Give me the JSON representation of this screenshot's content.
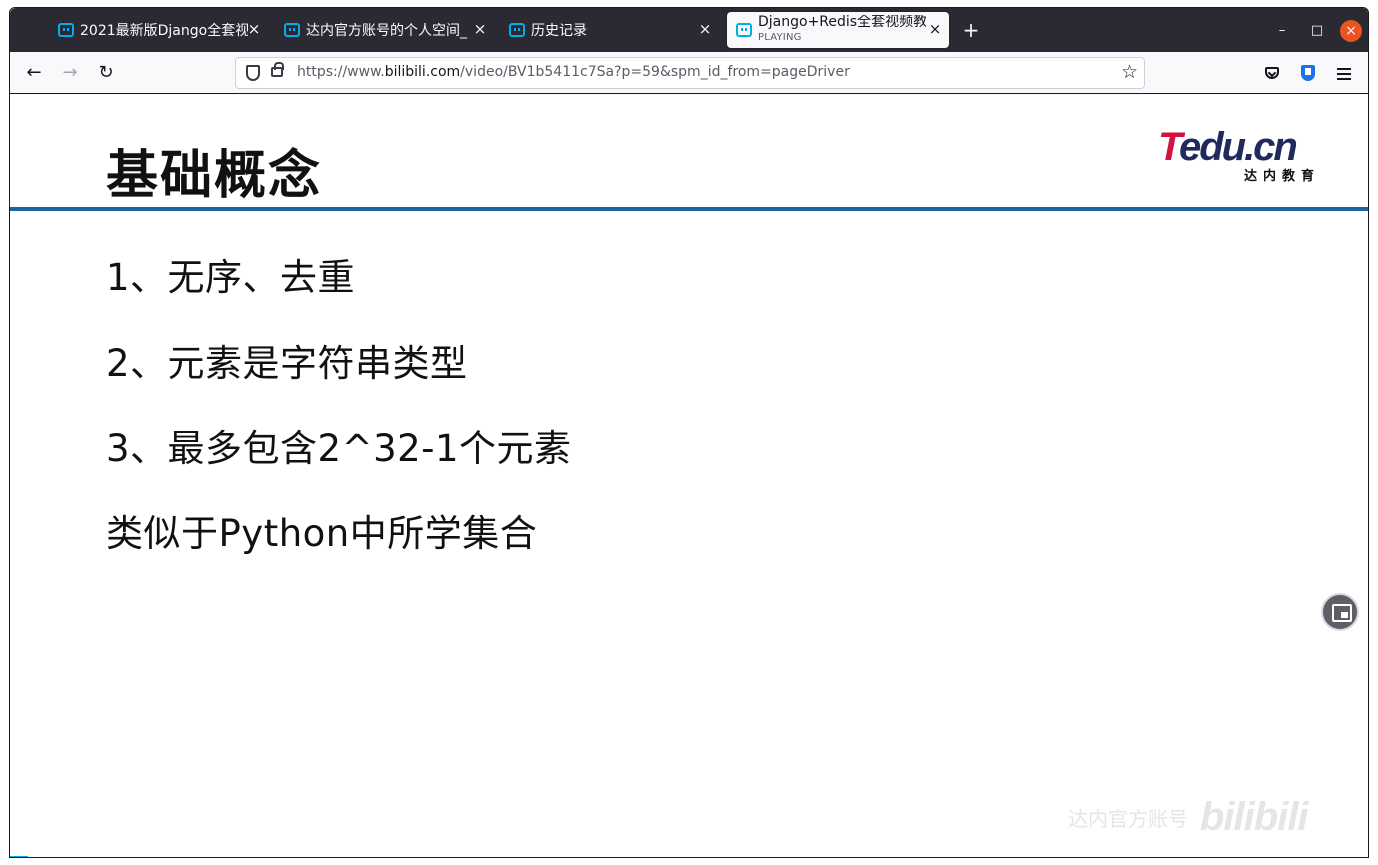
{
  "browser": {
    "tabs": [
      {
        "title": "2021最新版Django全套视",
        "active": false
      },
      {
        "title": "达内官方账号的个人空间_",
        "active": false
      },
      {
        "title": "历史记录",
        "active": false
      },
      {
        "title": "Django+Redis全套视频教",
        "subtitle": "PLAYING",
        "active": true
      }
    ],
    "tab_close_glyph": "×",
    "new_tab_glyph": "+",
    "window_controls": {
      "minimize": "–",
      "maximize": "□",
      "close": "×"
    },
    "nav": {
      "back": "←",
      "forward": "→",
      "reload": "↻"
    },
    "url": {
      "prefix": "https://www.",
      "domain": "bilibili.com",
      "path": "/video/BV1b5411c7Sa?p=59&spm_id_from=pageDriver"
    },
    "bookmark_glyph": "☆",
    "icons": [
      "shield-icon",
      "lock-icon",
      "star-icon",
      "pocket-icon",
      "extension-icon",
      "menu-icon"
    ],
    "accent_color": "#00aeec",
    "close_button_color": "#e95420"
  },
  "slide": {
    "title": "基础概念",
    "logo": {
      "brand_prefix": "T",
      "brand_rest": "edu.cn",
      "subtitle": "达内教育"
    },
    "points": [
      "1、无序、去重",
      "2、元素是字符串类型",
      "3、最多包含2^32-1个元素",
      "类似于Python中所学集合"
    ],
    "rule_color": "#1d62a5"
  },
  "player": {
    "watermark_account": "达内官方账号",
    "watermark_logo": "bilibili",
    "pip_icon": "picture-in-picture-icon"
  }
}
